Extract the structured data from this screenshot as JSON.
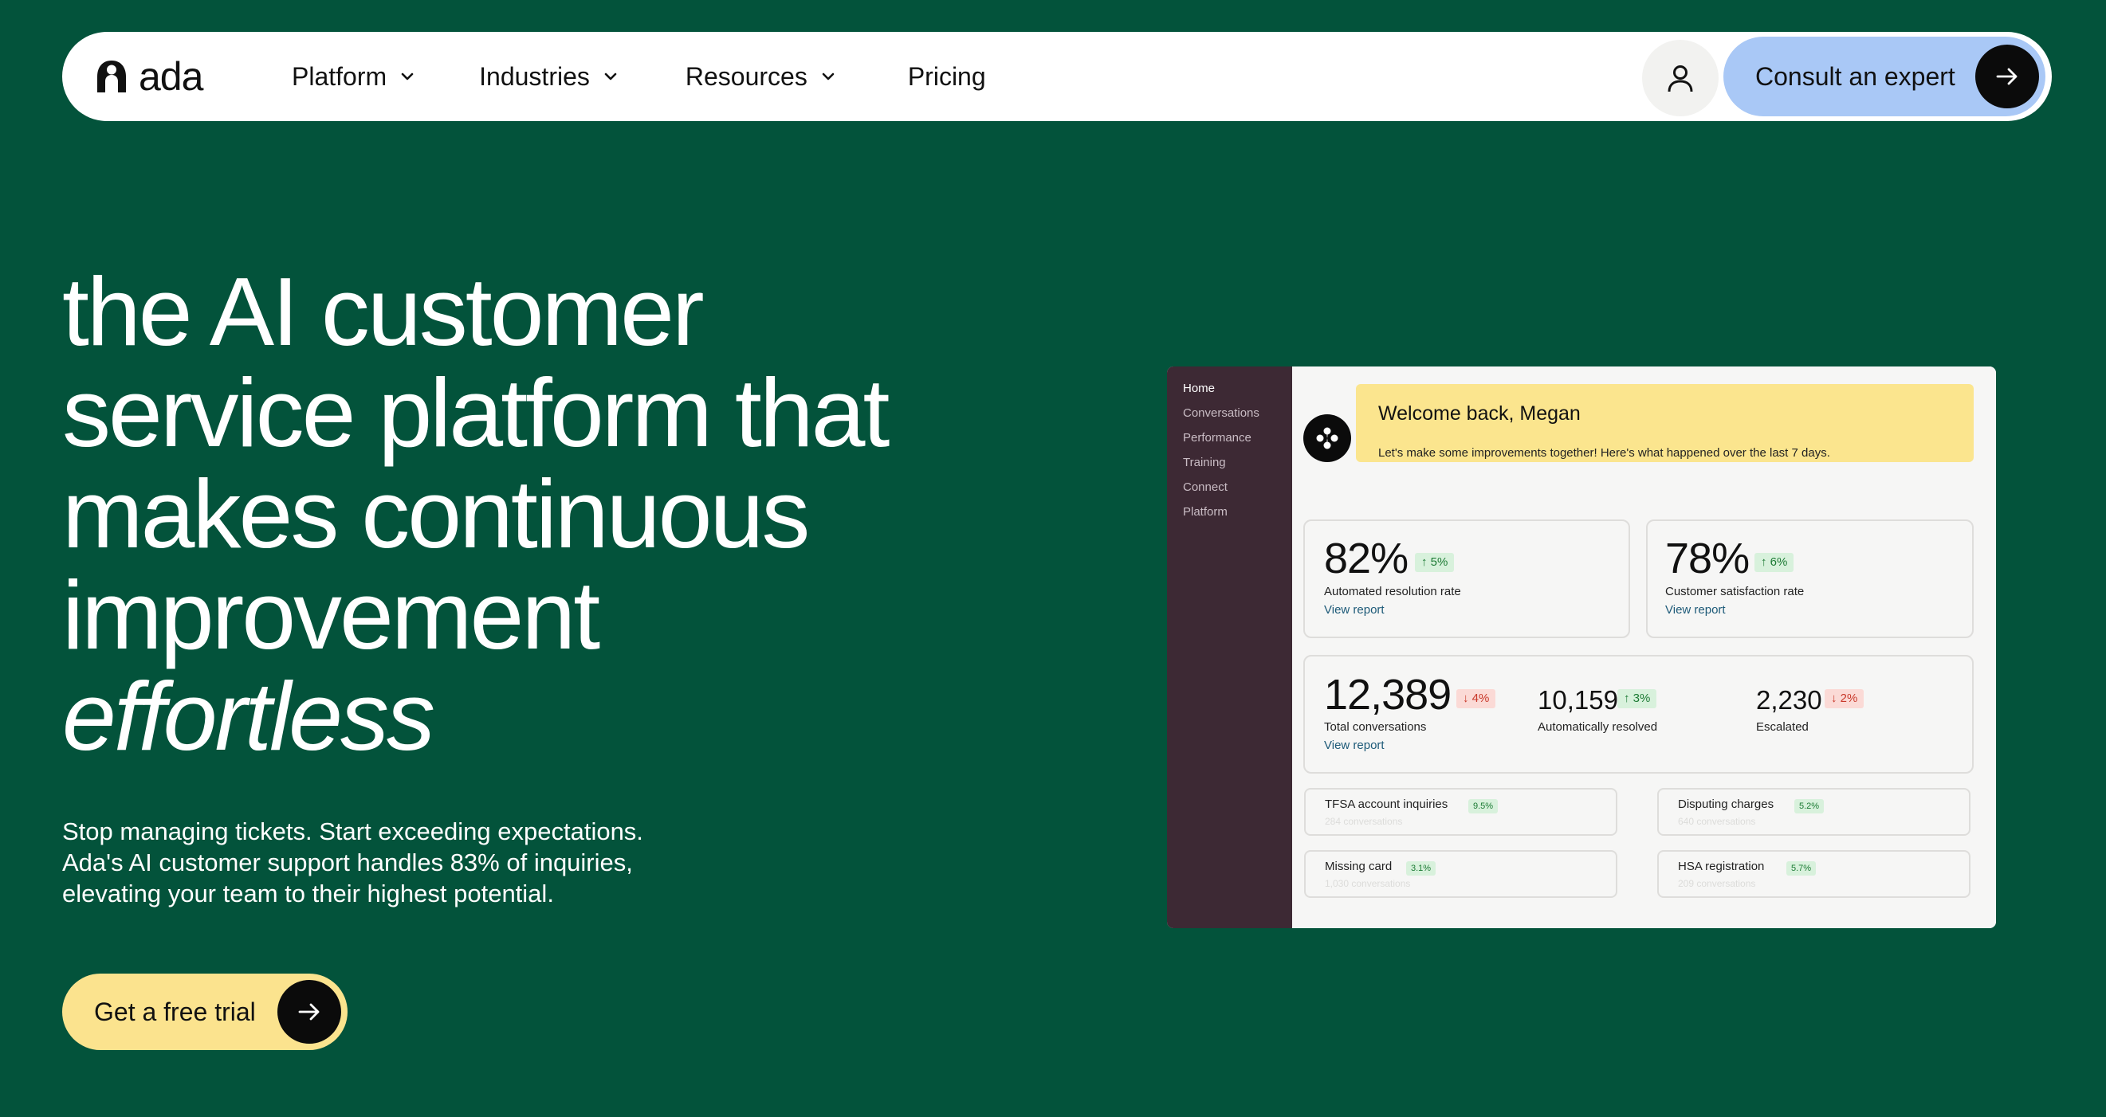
{
  "nav": {
    "logo_text": "ada",
    "items": [
      {
        "label": "Platform",
        "has_dropdown": true
      },
      {
        "label": "Industries",
        "has_dropdown": true
      },
      {
        "label": "Resources",
        "has_dropdown": true
      },
      {
        "label": "Pricing",
        "has_dropdown": false
      }
    ],
    "account_icon": "user-icon",
    "cta_label": "Consult an expert",
    "cta_icon": "arrow-right-icon"
  },
  "hero": {
    "headline_lines": [
      "the AI customer",
      "service platform that",
      "makes continuous",
      "improvement"
    ],
    "headline_emphasis": "effortless",
    "subcopy_lines": [
      "Stop managing tickets. Start exceeding expectations.",
      "Ada's AI customer support handles 83% of inquiries,",
      "elevating your team to their highest potential."
    ],
    "cta_label": "Get a free trial",
    "cta_icon": "arrow-right-icon"
  },
  "dashboard": {
    "sidebar": [
      "Home",
      "Conversations",
      "Performance",
      "Training",
      "Connect",
      "Platform"
    ],
    "welcome": {
      "title": "Welcome back, Megan",
      "subtitle": "Let's make some improvements together! Here's what happened over the last 7 days."
    },
    "metrics": [
      {
        "value": "82%",
        "change": "↑ 5%",
        "trend": "up",
        "label": "Automated resolution rate",
        "link": "View report"
      },
      {
        "value": "78%",
        "change": "↑ 6%",
        "trend": "up",
        "label": "Customer satisfaction rate",
        "link": "View report"
      }
    ],
    "conversations": {
      "total": {
        "value": "12,389",
        "change": "↓ 4%",
        "trend": "down",
        "label": "Total conversations",
        "link": "View report"
      },
      "resolved": {
        "value": "10,159",
        "change": "↑ 3%",
        "trend": "up",
        "label": "Automatically resolved"
      },
      "escalated": {
        "value": "2,230",
        "change": "↓ 2%",
        "trend": "down",
        "label": "Escalated"
      }
    },
    "topics": [
      {
        "name": "TFSA account inquiries",
        "pct": "9.5%",
        "count": "284 conversations"
      },
      {
        "name": "Disputing charges",
        "pct": "5.2%",
        "count": "640 conversations"
      },
      {
        "name": "Missing card",
        "pct": "3.1%",
        "count": "1,030 conversations"
      },
      {
        "name": "HSA registration",
        "pct": "5.7%",
        "count": "209 conversations"
      }
    ],
    "colors": {
      "up": "#1c7a34",
      "down": "#c9392b",
      "accent_yellow": "#fbe58e",
      "sidebar": "#3d2934"
    }
  },
  "colors": {
    "background": "#03533b",
    "consult_button": "#a9c8f6",
    "trial_button": "#fbe38e"
  }
}
